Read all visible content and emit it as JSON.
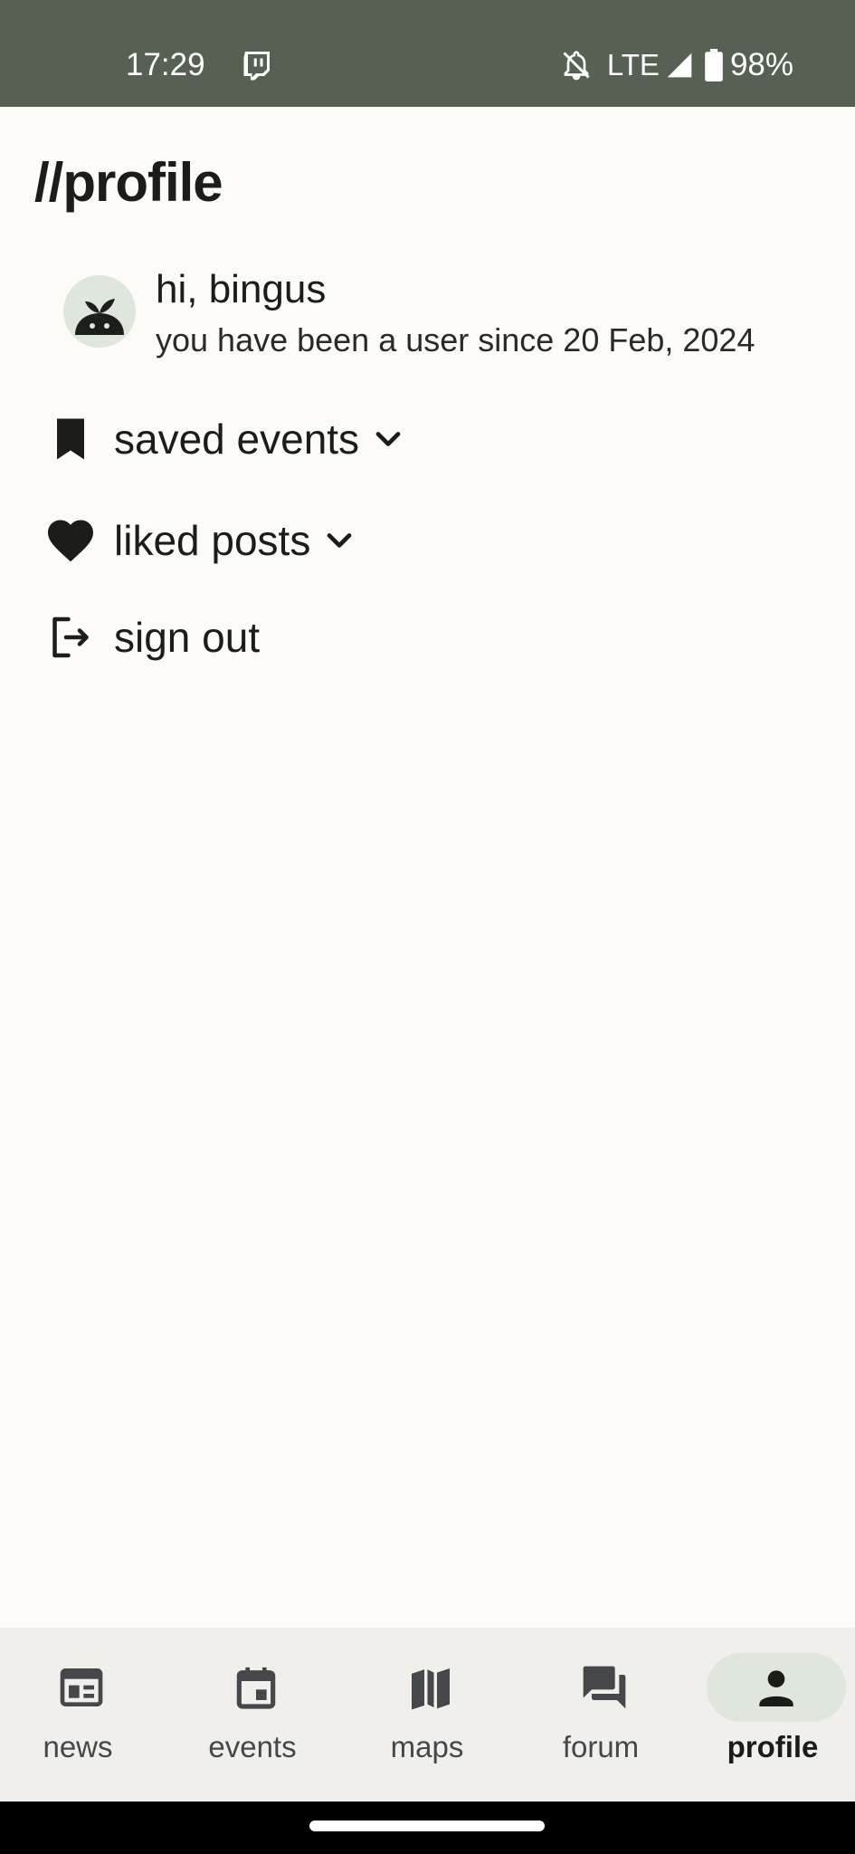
{
  "status_bar": {
    "time": "17:29",
    "network": "LTE",
    "battery": "98%",
    "icons": [
      "twitch-icon",
      "bell-off-icon",
      "signal-icon",
      "battery-icon"
    ],
    "background": "#566053"
  },
  "page": {
    "title": "//profile"
  },
  "user": {
    "greeting": "hi, bingus",
    "member_since": "you have been a user since 20 Feb, 2024"
  },
  "menu": {
    "saved_events": "saved events",
    "liked_posts": "liked posts",
    "sign_out": "sign out"
  },
  "nav": {
    "items": [
      {
        "label": "news",
        "icon": "newspaper-icon"
      },
      {
        "label": "events",
        "icon": "calendar-icon"
      },
      {
        "label": "maps",
        "icon": "map-icon"
      },
      {
        "label": "forum",
        "icon": "forum-icon"
      },
      {
        "label": "profile",
        "icon": "person-icon",
        "active": true
      }
    ]
  },
  "colors": {
    "background": "#fcfbf7",
    "nav_background": "#f0efeb",
    "active_pill": "#dfe6dc",
    "text": "#1c1c1a"
  }
}
